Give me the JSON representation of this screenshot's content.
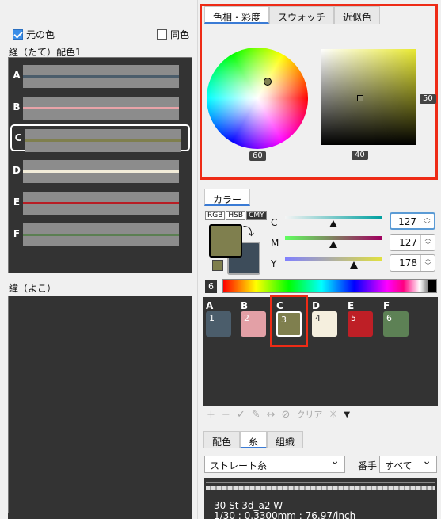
{
  "left_panel": {
    "original_color_label": "元の色",
    "same_color_label": "同色",
    "warp_title": "経（たて）配色1",
    "weft_title": "緯（よこ）",
    "warp_rows": [
      {
        "letter": "A",
        "color": "#4b5d6b"
      },
      {
        "letter": "B",
        "color": "#e8a3a8"
      },
      {
        "letter": "C",
        "color": "#7f7f4e"
      },
      {
        "letter": "D",
        "color": "#f2ecd9"
      },
      {
        "letter": "E",
        "color": "#b81d24"
      },
      {
        "letter": "F",
        "color": "#5b7f52"
      }
    ],
    "selected_row": "C"
  },
  "picker": {
    "tabs": [
      "色相・彩度",
      "スウォッチ",
      "近似色"
    ],
    "active_tab": "色相・彩度",
    "wheel_value": "60",
    "square_x_value": "40",
    "square_y_value": "50"
  },
  "color_tab": {
    "tab_label": "カラー",
    "modes": [
      "RGB",
      "HSB",
      "CMY"
    ],
    "active_mode": "CMY",
    "foreground": "#7f7f4e",
    "background": "#3d4c5a",
    "sliders": [
      {
        "label": "C",
        "value": "127"
      },
      {
        "label": "M",
        "value": "127"
      },
      {
        "label": "Y",
        "value": "178"
      }
    ]
  },
  "palette": {
    "count_badge": "6",
    "swatches": [
      {
        "letter": "A",
        "number": "1",
        "color": "#4b5d6b"
      },
      {
        "letter": "B",
        "number": "2",
        "color": "#e3a0a6"
      },
      {
        "letter": "C",
        "number": "3",
        "color": "#7f7f4e"
      },
      {
        "letter": "D",
        "number": "4",
        "color": "#f5efde"
      },
      {
        "letter": "E",
        "number": "5",
        "color": "#be1f26"
      },
      {
        "letter": "F",
        "number": "6",
        "color": "#5d8155"
      }
    ],
    "selected": "C"
  },
  "toolbar": {
    "add": "+",
    "remove": "−",
    "check": "✓",
    "edit": "✎",
    "swap": "↔",
    "block": "⊘",
    "clear_label": "クリア",
    "star": "✳",
    "dropdown": "▼"
  },
  "bottom": {
    "tabs": [
      "配色",
      "糸",
      "組織"
    ],
    "active_tab": "糸",
    "thread_type": "ストレート糸",
    "bante_label": "番手",
    "bante_value": "すべて",
    "thread_name": "30 St 3d_a2 W",
    "thread_info": "1/30 : 0.3300mm : 76.97/inch"
  }
}
